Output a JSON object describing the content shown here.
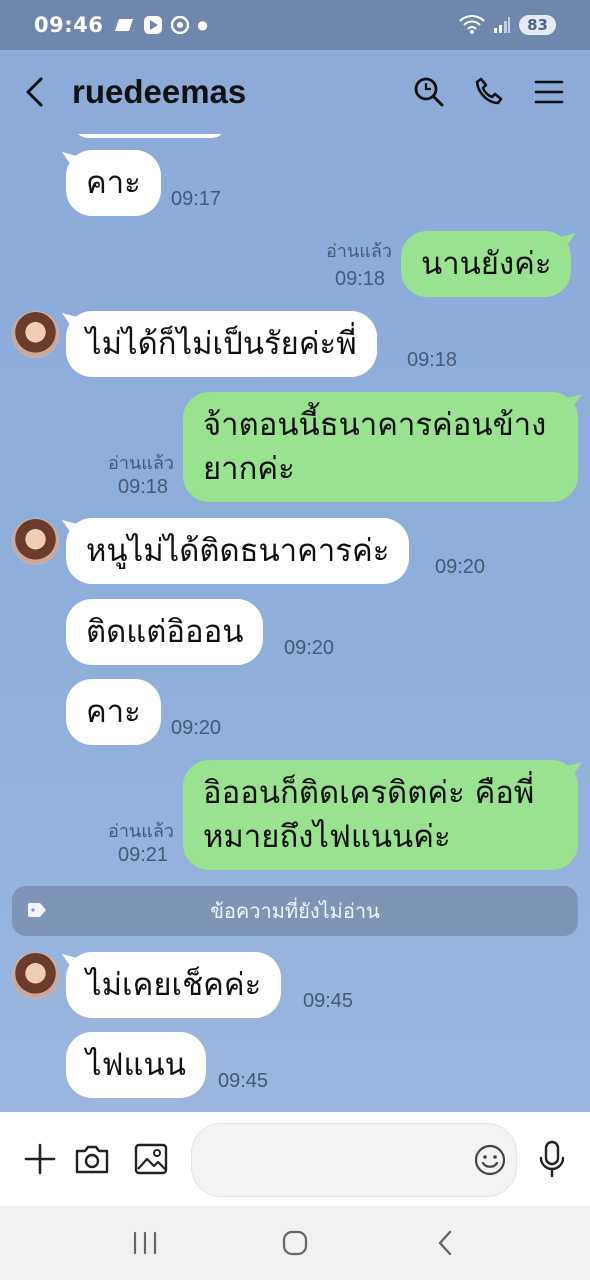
{
  "status_bar": {
    "time": "09:46",
    "battery": "83"
  },
  "header": {
    "title": "ruedeemas"
  },
  "chat": {
    "messages": [
      {
        "direction": "in",
        "text": "คาะ",
        "time": "09:17"
      },
      {
        "direction": "out",
        "text": "นานยังค่ะ",
        "time": "09:18",
        "read": "อ่านแล้ว"
      },
      {
        "direction": "in",
        "text": "ไม่ได้ก็ไม่เป็นรัยค่ะพี่",
        "time": "09:18"
      },
      {
        "direction": "out",
        "text": "จ้าตอนนี้ธนาคารค่อนข้างยากค่ะ",
        "time": "09:18",
        "read": "อ่านแล้ว"
      },
      {
        "direction": "in",
        "text": "หนูไม่ได้ติดธนาคารค่ะ",
        "time": "09:20"
      },
      {
        "direction": "in",
        "text": "ติดแต่อิออน",
        "time": "09:20"
      },
      {
        "direction": "in",
        "text": "คาะ",
        "time": "09:20"
      },
      {
        "direction": "out",
        "text": "อิออนก็ติดเครดิตค่ะ คือพี่หมายถึงไฟแนนค่ะ",
        "time": "09:21",
        "read": "อ่านแล้ว"
      },
      {
        "direction": "in",
        "text": "ไม่เคยเช็คค่ะ",
        "time": "09:45"
      },
      {
        "direction": "in",
        "text": "ไฟแนน",
        "time": "09:45"
      }
    ],
    "unread_divider": "ข้อความที่ยังไม่อ่าน"
  },
  "input": {
    "placeholder": ""
  },
  "colors": {
    "background": "#8cabd9",
    "outgoing_bubble": "#99e28f",
    "incoming_bubble": "#ffffff",
    "status_bar": "#6f86ad"
  },
  "icons": [
    "back-icon",
    "search-icon",
    "phone-icon",
    "menu-icon",
    "plus-icon",
    "camera-icon",
    "image-icon",
    "emoji-icon",
    "mic-icon"
  ]
}
